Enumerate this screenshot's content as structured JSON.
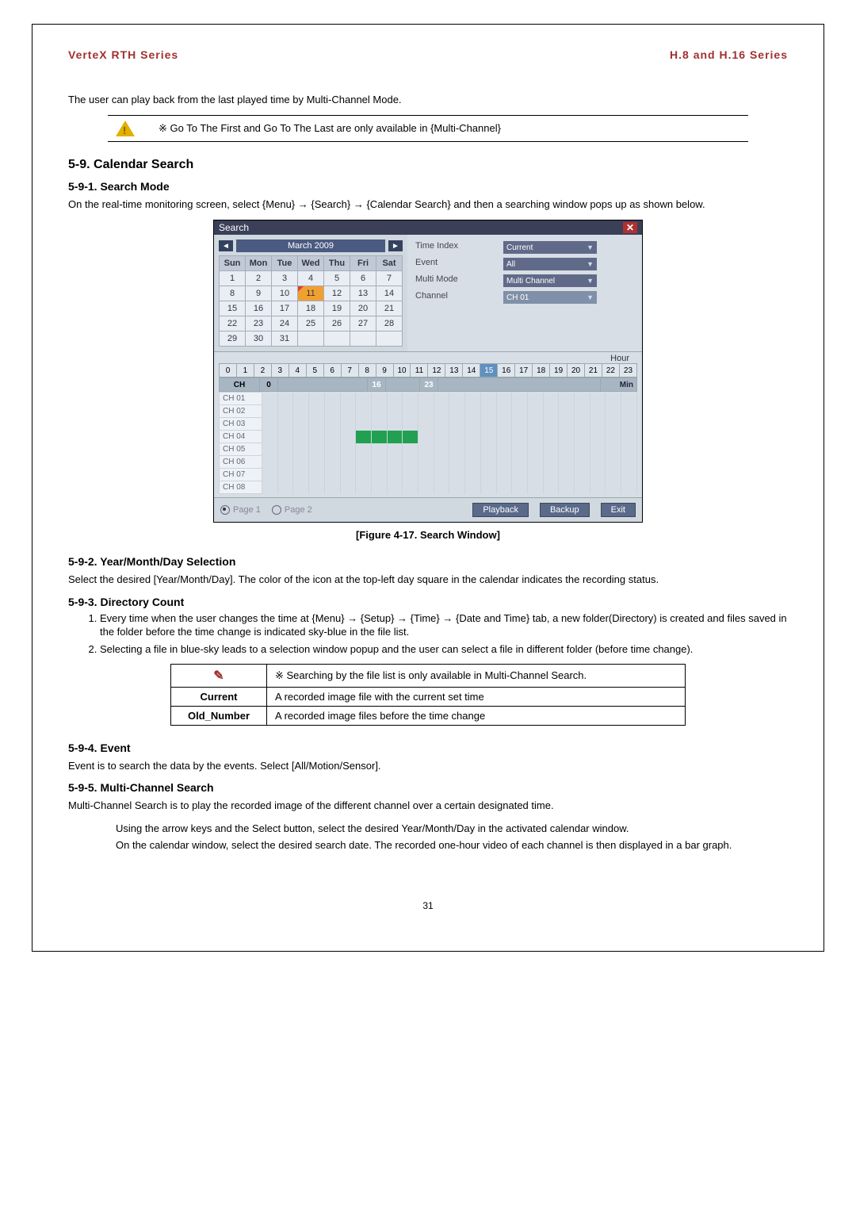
{
  "header": {
    "left": "VerteX RTH Series",
    "right": "H.8 and H.16 Series"
  },
  "intro": "The user can play back from the last played time by Multi-Channel Mode.",
  "note_goto": "※  Go To The First and Go To The Last are only available in {Multi-Channel}",
  "sec_59": "5-9.  Calendar Search",
  "sec_591_h": "5-9-1. Search Mode",
  "sec_591_p": "On the real-time monitoring screen, select {Menu} → {Search} → {Calendar Search} and then a searching window pops up as shown below.",
  "fig_caption": "[Figure 4-17. Search Window]",
  "sec_592_h": "5-9-2.  Year/Month/Day Selection",
  "sec_592_p": "Select the desired [Year/Month/Day]. The color of the icon at the top-left day square in the calendar indicates the recording status.",
  "sec_593_h": "5-9-3.  Directory Count",
  "sec_593_li1": "Every time when the user changes the time at {Menu} → {Setup} → {Time} → {Date and Time} tab, a new folder(Directory) is created and files saved in the folder before the time change is indicated sky-blue in the file list.",
  "sec_593_li2": "Selecting a file in blue-sky leads to a selection window popup and the user can select a file in different folder (before time change).",
  "table1": {
    "row1_note": "※ Searching by the file list is only available in Multi-Channel Search.",
    "row2_k": "Current",
    "row2_v": "A recorded image file with the current set time",
    "row3_k": "Old_Number",
    "row3_v": "A recorded image files before the time change"
  },
  "sec_594_h": "5-9-4.  Event",
  "sec_594_p": "Event is to search the data by the events. Select [All/Motion/Sensor].",
  "sec_595_h": "5-9-5.  Multi-Channel Search",
  "sec_595_p": "Multi-Channel Search is to play the recorded image of the different channel over a certain designated time.",
  "sec_595_b1": "Using the arrow keys and the Select button, select the desired Year/Month/Day in the activated calendar window.",
  "sec_595_b2": "On the calendar window, select the desired search date. The recorded one-hour video of each channel is then displayed in a bar graph.",
  "page_number": "31",
  "search_window": {
    "title": "Search",
    "close": "✕",
    "month_label": "March 2009",
    "days_head": [
      "Sun",
      "Mon",
      "Tue",
      "Wed",
      "Thu",
      "Fri",
      "Sat"
    ],
    "weeks": [
      [
        "1",
        "2",
        "3",
        "4",
        "5",
        "6",
        "7"
      ],
      [
        "8",
        "9",
        "10",
        "11",
        "12",
        "13",
        "14"
      ],
      [
        "15",
        "16",
        "17",
        "18",
        "19",
        "20",
        "21"
      ],
      [
        "22",
        "23",
        "24",
        "25",
        "26",
        "27",
        "28"
      ],
      [
        "29",
        "30",
        "31",
        "",
        "",
        "",
        ""
      ]
    ],
    "selected_day": "11",
    "opts": {
      "time_index_l": "Time Index",
      "time_index_v": "Current",
      "event_l": "Event",
      "event_v": "All",
      "multi_l": "Multi Mode",
      "multi_v": "Multi Channel",
      "channel_l": "Channel",
      "channel_v": "CH 01"
    },
    "hour_label": "Hour",
    "hours": [
      "0",
      "1",
      "2",
      "3",
      "4",
      "5",
      "6",
      "7",
      "8",
      "9",
      "10",
      "11",
      "12",
      "13",
      "14",
      "15",
      "16",
      "17",
      "18",
      "19",
      "20",
      "21",
      "22",
      "23"
    ],
    "hour_selected": 15,
    "min_head_ch": "CH",
    "min_head_0": "0",
    "min_mark_16": "16",
    "min_mark_23": "23",
    "min_label": "Min",
    "channels": [
      "CH 01",
      "CH 02",
      "CH 03",
      "CH 04",
      "CH 05",
      "CH 06",
      "CH 07",
      "CH 08"
    ],
    "page1": "Page 1",
    "page2": "Page 2",
    "btn_playback": "Playback",
    "btn_backup": "Backup",
    "btn_exit": "Exit"
  }
}
